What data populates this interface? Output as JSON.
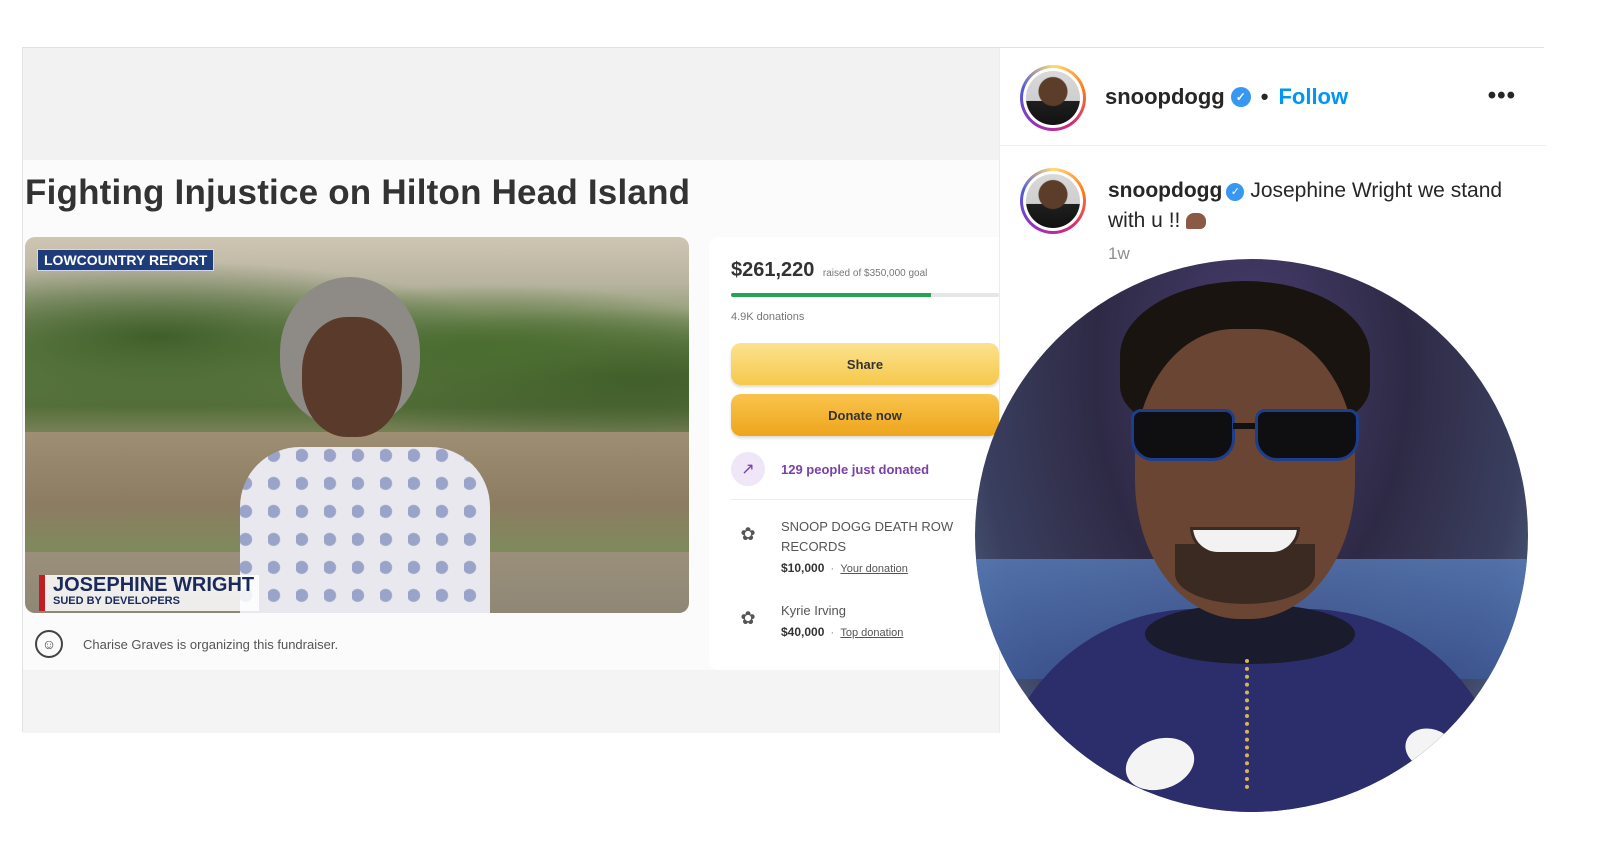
{
  "gofundme": {
    "title": "Fighting Injustice on Hilton Head Island",
    "video": {
      "tag": "LOWCOUNTRY REPORT",
      "name": "JOSEPHINE WRIGHT",
      "subtitle": "SUED BY DEVELOPERS"
    },
    "organizer_text": "Charise Graves is organizing this fundraiser.",
    "raised_amount": "$261,220",
    "goal_text": "raised of $350,000 goal",
    "progress_fraction": 0.746,
    "donations_count": "4.9K donations",
    "share_label": "Share",
    "donate_label": "Donate now",
    "just_donated": "129 people just donated",
    "donors": [
      {
        "name": "SNOOP DOGG DEATH ROW RECORDS",
        "amount": "$10,000",
        "tag": "Your donation"
      },
      {
        "name": "Kyrie Irving",
        "amount": "$40,000",
        "tag": "Top donation"
      }
    ]
  },
  "instagram": {
    "username": "snoopdogg",
    "follow_label": "Follow",
    "caption": "Josephine Wright we stand with u !!",
    "time": "1w"
  },
  "icons": {
    "verified": "verified-check-icon",
    "more": "more-options-icon",
    "user": "user-icon",
    "trend": "trending-icon",
    "donor": "donor-badge-icon",
    "flex": "flexed-arm-icon"
  },
  "colors": {
    "follow_blue": "#0095f6",
    "verified_blue": "#3897f0",
    "progress_green": "#23a455",
    "donate_yellow": "#eea51c",
    "purple_accent": "#7a3fa8"
  }
}
